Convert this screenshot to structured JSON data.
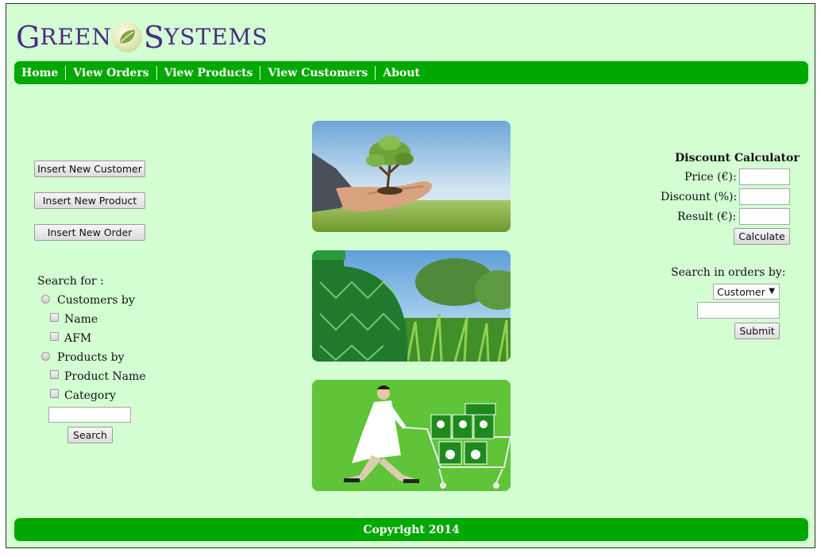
{
  "logo": {
    "first_initial": "G",
    "first_rest": "REEN",
    "second_initial": "S",
    "second_rest": "YSTEMS"
  },
  "nav": {
    "items": [
      "Home",
      "View Orders",
      "View Products",
      "View Customers",
      "About"
    ]
  },
  "actions": {
    "insert_customer": "Insert New Customer",
    "insert_product": "Insert New Product",
    "insert_order": "Insert New Order"
  },
  "search": {
    "title": "Search for :",
    "customers_by": "Customers by",
    "name": "Name",
    "afm": "AFM",
    "products_by": "Products by",
    "product_name": "Product Name",
    "category": "Category",
    "query_value": "",
    "button": "Search"
  },
  "calculator": {
    "title": "Discount Calculator",
    "price_label": "Price (€):",
    "discount_label": "Discount (%):",
    "result_label": "Result (€):",
    "price_value": "",
    "discount_value": "",
    "result_value": "",
    "button": "Calculate"
  },
  "orders_search": {
    "title": "Search in orders by:",
    "selected": "Customer",
    "query_value": "",
    "button": "Submit"
  },
  "images": [
    "plant-in-hands-photo",
    "green-glass-bottle-grass-photo",
    "doctor-pushing-recycling-cart-illustration"
  ],
  "footer": {
    "text": "Copyright 2014"
  },
  "colors": {
    "page_bg": "#d3ffd3",
    "bar": "#00a800",
    "logo_text": "#4b2a86"
  }
}
